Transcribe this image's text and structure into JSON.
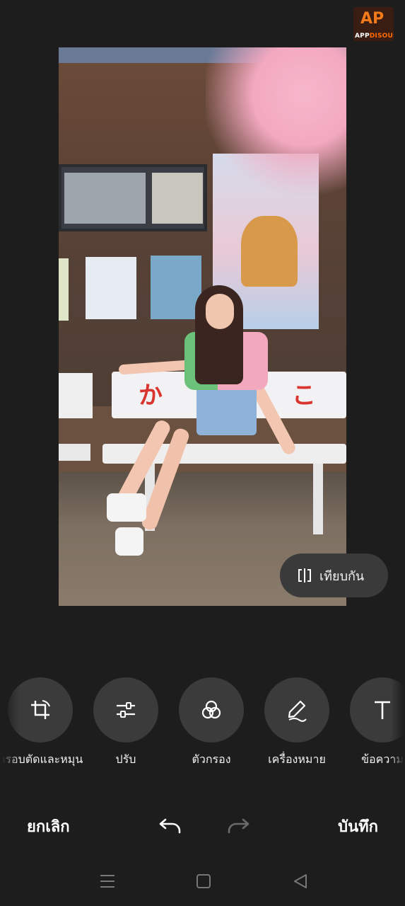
{
  "watermark": {
    "logo_text_a": "APP",
    "logo_text_b": "DISOUS",
    "mark": "AP"
  },
  "preview": {
    "image_alt": "photo-preview"
  },
  "compare_button": {
    "label": "เทียบกัน",
    "icon": "compare-icon"
  },
  "tools": [
    {
      "label": "ครอบตัดและหมุน",
      "icon": "crop-rotate-icon"
    },
    {
      "label": "ปรับ",
      "icon": "sliders-icon"
    },
    {
      "label": "ตัวกรอง",
      "icon": "filters-icon"
    },
    {
      "label": "เครื่องหมาย",
      "icon": "pen-markup-icon"
    },
    {
      "label": "ข้อความ",
      "icon": "text-icon"
    }
  ],
  "actions": {
    "cancel_label": "ยกเลิก",
    "save_label": "บันทึก",
    "undo_icon": "undo-icon",
    "redo_icon": "redo-icon"
  },
  "system_nav": {
    "menu": "menu-icon",
    "home": "home-icon",
    "back": "back-icon"
  },
  "colors": {
    "background": "#1d1d1d",
    "tool_circle": "#3b3b3b",
    "pill": "#3a3a3a"
  }
}
